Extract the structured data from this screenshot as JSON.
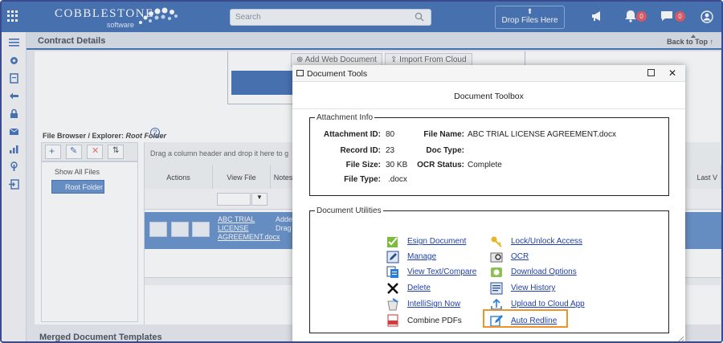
{
  "app": {
    "logo_main": "COBBLESTONE",
    "logo_sub": "software",
    "search_placeholder": "Search",
    "drop_files": "Drop Files Here",
    "notifications_count": "0",
    "messages_count": "0"
  },
  "page": {
    "title": "Contract Details",
    "back_to_top": "Back to Top",
    "add_web_document": "Add Web Document",
    "import_from_cloud": "Import From Cloud",
    "file_browser_label": "File Browser / Explorer:",
    "file_browser_folder": "Root Folder",
    "help": "?",
    "show_all_files": "Show All Files",
    "root_folder": "Root Folder",
    "group_hint": "Drag a column header and drop it here to g",
    "columns": {
      "actions": "Actions",
      "view_file": "View File",
      "notes": "Notes",
      "last": "Last V"
    },
    "row_file_link": "ABC TRIAL LICENSE AGREEMENT.docx",
    "row_notes": "Adde Drag",
    "merged_templates": "Merged Document Templates"
  },
  "modal": {
    "title": "Document Tools",
    "toolbox_title": "Document Toolbox",
    "attachment_legend": "Attachment Info",
    "attachment": {
      "id_label": "Attachment ID:",
      "id": "80",
      "record_label": "Record ID:",
      "record": "23",
      "size_label": "File Size:",
      "size": "30 KB",
      "type_label": "File Type:",
      "type": ".docx",
      "name_label": "File Name:",
      "name": "ABC TRIAL LICENSE AGREEMENT.docx",
      "doctype_label": "Doc Type:",
      "doctype": "",
      "ocr_label": "OCR Status:",
      "ocr": "Complete"
    },
    "utilities_legend": "Document Utilities",
    "utilities_left": [
      "Esign Document",
      "Manage",
      "View Text/Compare",
      "Delete",
      "IntelliSign Now",
      "Combine PDFs"
    ],
    "utilities_right": [
      "Lock/Unlock Access",
      "OCR",
      "Download Options",
      "View History",
      "Upload to Cloud App",
      "Auto Redline"
    ]
  },
  "colors": {
    "brand": "#4a76b8",
    "link": "#1f3fa8",
    "highlight": "#f0932b"
  }
}
